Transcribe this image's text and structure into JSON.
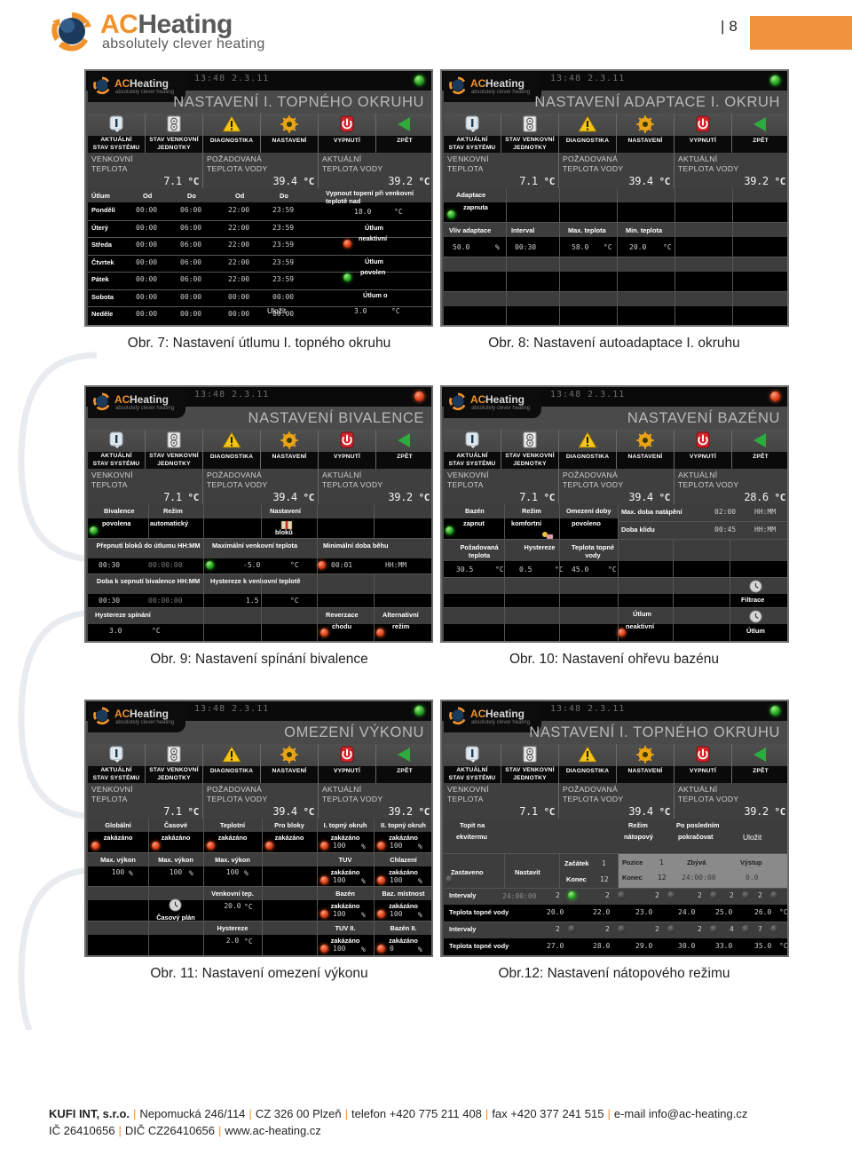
{
  "header": {
    "logo": {
      "ac": "AC",
      "heating": "Heating",
      "tagline": "absolutely clever heating",
      "mark": "ac-heating-logo-icon"
    },
    "page_number": "8",
    "page_bar": "|",
    "accent_color": "#F0923E"
  },
  "common": {
    "clock": "13:48 2.3.11",
    "nav": [
      {
        "label1": "AKTUÁLNÍ",
        "label2": "STAV SYSTÉMU",
        "icon": "info-icon"
      },
      {
        "label1": "STAV VENKOVNÍ",
        "label2": "JEDNOTKY",
        "icon": "outdoor-unit-icon"
      },
      {
        "label1": "DIAGNOSTIKA",
        "label2": "",
        "icon": "warning-icon"
      },
      {
        "label1": "NASTAVENÍ",
        "label2": "",
        "icon": "gear-icon"
      },
      {
        "label1": "VYPNUTÍ",
        "label2": "",
        "icon": "power-icon"
      },
      {
        "label1": "ZPĚT",
        "label2": "",
        "icon": "back-arrow-icon"
      }
    ],
    "temps": [
      {
        "l1": "VENKOVNÍ",
        "l2": "TEPLOTA",
        "value": "7.1",
        "unit": "°C"
      },
      {
        "l1": "POŽADOVANÁ",
        "l2": "TEPLOTA VODY",
        "value": "39.4",
        "unit": "°C"
      },
      {
        "l1": "AKTUÁLNÍ",
        "l2": "TEPLOTA VODY",
        "value": "39.2",
        "unit": "°C"
      }
    ]
  },
  "figures": [
    {
      "id": "fig7",
      "title": "NASTAVENÍ I. TOPNÉHO OKRUHU",
      "status_led": "green",
      "caption": "Obr. 7: Nastavení útlumu I. topného okruhu",
      "schedule": {
        "headers": [
          "Útlum",
          "Od",
          "Do",
          "Od",
          "Do"
        ],
        "rows": [
          {
            "day": "Pondělí",
            "od1": "00:00",
            "do1": "06:00",
            "od2": "22:00",
            "do2": "23:59"
          },
          {
            "day": "Úterý",
            "od1": "00:00",
            "do1": "06:00",
            "od2": "22:00",
            "do2": "23:59"
          },
          {
            "day": "Středa",
            "od1": "00:00",
            "do1": "06:00",
            "od2": "22:00",
            "do2": "23:59"
          },
          {
            "day": "Čtvrtek",
            "od1": "00:00",
            "do1": "06:00",
            "od2": "22:00",
            "do2": "23:59"
          },
          {
            "day": "Pátek",
            "od1": "00:00",
            "do1": "06:00",
            "od2": "22:00",
            "do2": "23:59"
          },
          {
            "day": "Sobota",
            "od1": "00:00",
            "do1": "00:00",
            "od2": "00:00",
            "do2": "00:00"
          },
          {
            "day": "Neděle",
            "od1": "00:00",
            "do1": "00:00",
            "od2": "00:00",
            "do2": "00:00"
          }
        ]
      },
      "right": {
        "cutoff_label": "Vypnout topení při venkovní teplotě nad",
        "cutoff_value": "18.0",
        "cutoff_unit": "°C",
        "state1_l1": "Útlum",
        "state1_l2": "neaktivní",
        "state1_led": "red",
        "state2_l1": "Útlum",
        "state2_l2": "povolen",
        "state2_led": "green",
        "state3_l1": "Útlum o",
        "state3_value": "3.0",
        "state3_unit": "°C",
        "save": "Uložit"
      }
    },
    {
      "id": "fig8",
      "title": "NASTAVENÍ ADAPTACE I. OKRUH",
      "status_led": "green",
      "caption": "Obr. 8: Nastavení autoadaptace I. okruhu",
      "adapt": {
        "state_l1": "Adaptace",
        "state_l2": "zapnuta",
        "state_led": "green",
        "headers": [
          "Vliv adaptace",
          "Interval",
          "Max. teplota",
          "Min. teplota"
        ],
        "values": [
          "50.0",
          "00:30",
          "58.0",
          "20.0"
        ],
        "units": [
          "%",
          "",
          "°C",
          "°C"
        ]
      }
    },
    {
      "id": "fig9",
      "title": "NASTAVENÍ BIVALENCE",
      "status_led": "red",
      "caption": "Obr. 9: Nastavení spínání bivalence",
      "biv": {
        "r1": [
          {
            "h": "Bivalence",
            "v": "povolena",
            "led": "green"
          },
          {
            "h": "Režim",
            "v": "automatický"
          },
          {
            "h": "",
            "v": ""
          },
          {
            "h": "Nastavení",
            "v": "bloků",
            "icon": "book-icon"
          }
        ],
        "h2": [
          "Přepnutí bloků do útlumu HH:MM",
          "Maximální venkovní teplota",
          "Minimální doba běhu"
        ],
        "v2a": "00:30",
        "v2b": "00:00:00",
        "v2c": "-5.0",
        "v2c_unit": "°C",
        "v2c_led": "green",
        "v2d": "00:01",
        "v2d_unit": "HH:MM",
        "v2d_led": "red",
        "h3": [
          "Doba k sepnutí bivalence HH:MM",
          "Hystereze k venkovní teplotě"
        ],
        "v3a": "00:30",
        "v3b": "00:00:00",
        "v3c": "1.5",
        "v3c_unit": "°C",
        "h4": "Hystereze spínání",
        "v4": "3.0",
        "v4_unit": "°C",
        "rev_l1": "Reverzace",
        "rev_l2": "chodu",
        "rev_led": "red",
        "alt_l1": "Alternativní",
        "alt_l2": "režim",
        "alt_led": "red"
      }
    },
    {
      "id": "fig10",
      "title": "NASTAVENÍ BAZÉNU",
      "status_led": "red",
      "caption": "Obr. 10: Nastavení ohřevu bazénu",
      "temps_override": [
        null,
        null,
        {
          "l1": "AKTUÁLNÍ",
          "l2": "TEPLOTA VODY",
          "value": "28.6",
          "unit": "°C"
        }
      ],
      "pool": {
        "c1_h": "Bazén",
        "c1_v": "zapnut",
        "c1_led": "green",
        "c2_h": "Režim",
        "c2_v": "komfortní",
        "c2_icon": "comfort-icon",
        "c3_h": "Omezení doby",
        "c3_v": "povoleno",
        "r1_lbl": "Max. doba natápění",
        "r1_val": "02:00",
        "r1_unit": "HH:MM",
        "r2_lbl": "Doba klidu",
        "r2_val": "00:45",
        "r2_unit": "HH:MM",
        "h2": [
          "Požadovaná teplota",
          "Hystereze",
          "Teplota topné vody"
        ],
        "v2": [
          "30.5",
          "0.5",
          "45.0"
        ],
        "u2": [
          "°C",
          "°C",
          "°C"
        ],
        "filter_label": "Filtrace",
        "filter_icon": "clock-icon",
        "utlum_l1": "Útlum",
        "utlum_l2": "neaktivní",
        "utlum_led": "red",
        "utlum_btn": "Útlum",
        "utlum_btn_icon": "clock-icon"
      }
    },
    {
      "id": "fig11",
      "title": "OMEZENÍ VÝKONU",
      "status_led": "green",
      "caption": "Obr. 11: Nastavení omezení výkonu",
      "power": {
        "row1": [
          {
            "h": "Globální",
            "v": "zakázáno",
            "led": "red"
          },
          {
            "h": "Časové",
            "v": "zakázáno",
            "led": "red"
          },
          {
            "h": "Teplotní",
            "v": "zakázáno",
            "led": "red"
          },
          {
            "h": "Pro bloky",
            "v": "zakázáno",
            "led": "red"
          },
          {
            "h": "I. topný okruh",
            "v": "zakázáno",
            "led": "red",
            "pct": "100",
            "unit": "%"
          },
          {
            "h": "II. topný okruh",
            "v": "zakázáno",
            "led": "red",
            "pct": "100",
            "unit": "%"
          }
        ],
        "row2": [
          {
            "h": "Max. výkon",
            "v": "100",
            "unit": "%"
          },
          {
            "h": "Max. výkon",
            "v": "100",
            "unit": "%"
          },
          {
            "h": "Max. výkon",
            "v": "100",
            "unit": "%"
          },
          {
            "h": "",
            "v": ""
          },
          {
            "h": "TUV",
            "v": "zakázáno",
            "led": "red",
            "pct": "100",
            "unit": "%"
          },
          {
            "h": "Chlazení",
            "v": "zakázáno",
            "led": "red",
            "pct": "100",
            "unit": "%"
          }
        ],
        "row3": [
          {
            "h": "",
            "v": ""
          },
          {
            "h": "",
            "v": "Časový plán",
            "icon": "clock-icon"
          },
          {
            "h": "Venkovní tep.",
            "v": "20.0",
            "unit": "°C"
          },
          {
            "h": "",
            "v": ""
          },
          {
            "h": "Bazén",
            "v": "zakázáno",
            "led": "red",
            "pct": "100",
            "unit": "%"
          },
          {
            "h": "Baz. místnost",
            "v": "zakázáno",
            "led": "red",
            "pct": "100",
            "unit": "%"
          }
        ],
        "row4": [
          {
            "h": "",
            "v": ""
          },
          {
            "h": "",
            "v": ""
          },
          {
            "h": "Hystereze",
            "v": "2.0",
            "unit": "°C"
          },
          {
            "h": "",
            "v": ""
          },
          {
            "h": "TUV II.",
            "v": "zakázáno",
            "led": "red",
            "pct": "100",
            "unit": "%"
          },
          {
            "h": "Bazén II.",
            "v": "zakázáno",
            "led": "red",
            "pct": "0",
            "unit": "%"
          }
        ]
      }
    },
    {
      "id": "fig12",
      "title": "NASTAVENÍ I. TOPNÉHO OKRUHU",
      "status_led": "green",
      "caption": "Obr.12: Nastavení nátopového režimu",
      "dry": {
        "c1_l1": "Topit na",
        "c1_l2": "ekvitermu",
        "mode_l1": "Režim",
        "mode_l2": "nátopový",
        "after_l1": "Po posledním",
        "after_l2": "pokračovat",
        "save": "Uložit",
        "stopped": "Zastaveno",
        "stopped_led": "dark",
        "set": "Nastavit",
        "start_lbl": "Začátek",
        "start_val": "1",
        "end_lbl": "Konec",
        "end_val": "12",
        "pos_lbl": "Pozice",
        "pos_val": "1",
        "zbyva_lbl": "Zbývá",
        "zbyva_val": "24:00:00",
        "vystup_lbl": "Výstup",
        "vystup_val": "0.0",
        "end2_lbl": "Konec",
        "end2_val": "12",
        "iv_lbl": "Intervaly",
        "iv_time": "24:00:00",
        "iv_row1": [
          "2",
          "2",
          "2",
          "2",
          "2",
          "2"
        ],
        "iv_row1_leds": [
          "green",
          "dark",
          "dark",
          "dark",
          "dark",
          "dark"
        ],
        "tw_lbl": "Teplota topné vody",
        "tw_row1": [
          "20.0",
          "22.0",
          "23.0",
          "24.0",
          "25.0",
          "26.0"
        ],
        "tw_row1_unit": "°C",
        "iv_row2": [
          "2",
          "2",
          "2",
          "2",
          "4",
          "7"
        ],
        "iv_row2_leds": [
          "dark",
          "dark",
          "dark",
          "dark",
          "dark",
          "dark"
        ],
        "tw_row2": [
          "27.0",
          "28.0",
          "29.0",
          "30.0",
          "33.0",
          "35.0"
        ],
        "tw_row2_unit": "°C"
      }
    }
  ],
  "footer": {
    "line1": [
      {
        "t": "KUFI INT, s.r.o.",
        "bold": true
      },
      {
        "t": "Nepomucká 246/114"
      },
      {
        "t": "CZ 326 00 Plzeň"
      },
      {
        "t": "telefon +420 775 211 408"
      },
      {
        "t": "fax +420 377 241 515"
      },
      {
        "t": "e-mail info@ac-heating.cz"
      }
    ],
    "line2": [
      {
        "t": "IČ 26410656"
      },
      {
        "t": "DIČ CZ26410656"
      },
      {
        "t": "www.ac-heating.cz"
      }
    ],
    "line1_text": "KUFI INT, s.r.o. | Nepomucká 246/114 | CZ 326 00 Plzeň | telefon +420 775 211 408 | fax +420 377 241 515 | e-mail info@ac-heating.cz",
    "line2_text": "IČ 26410656 | DIČ CZ26410656 | www.ac-heating.cz"
  }
}
